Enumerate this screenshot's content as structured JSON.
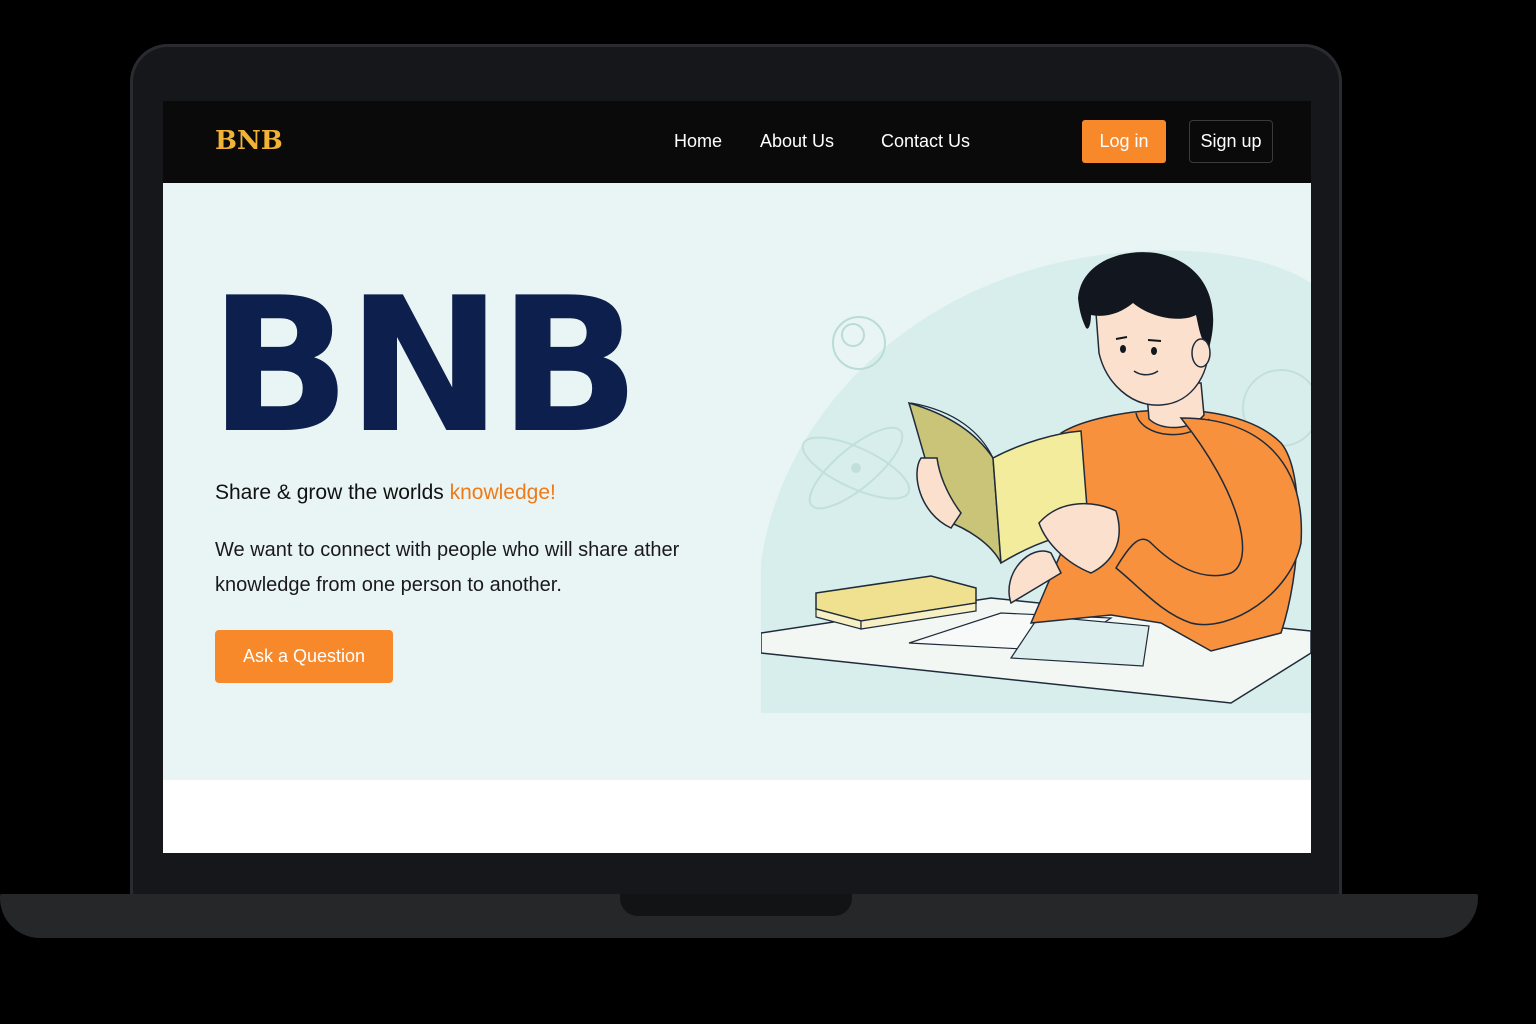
{
  "brand": {
    "logo": "BNB",
    "hero_title": "BNB",
    "accent_color": "#f7892b",
    "title_color": "#0d1f4c"
  },
  "nav": {
    "links": [
      {
        "label": "Home"
      },
      {
        "label": "About Us"
      },
      {
        "label": "Contact Us"
      }
    ],
    "login_label": "Log in",
    "signup_label": "Sign up"
  },
  "hero": {
    "tagline_main": "Share & grow the worlds ",
    "tagline_accent": "knowledge!",
    "description": "We want to connect with people who will share ather knowledge from one person to another.",
    "cta_label": "Ask a Question",
    "illustration": "person-reading-book-illustration"
  }
}
